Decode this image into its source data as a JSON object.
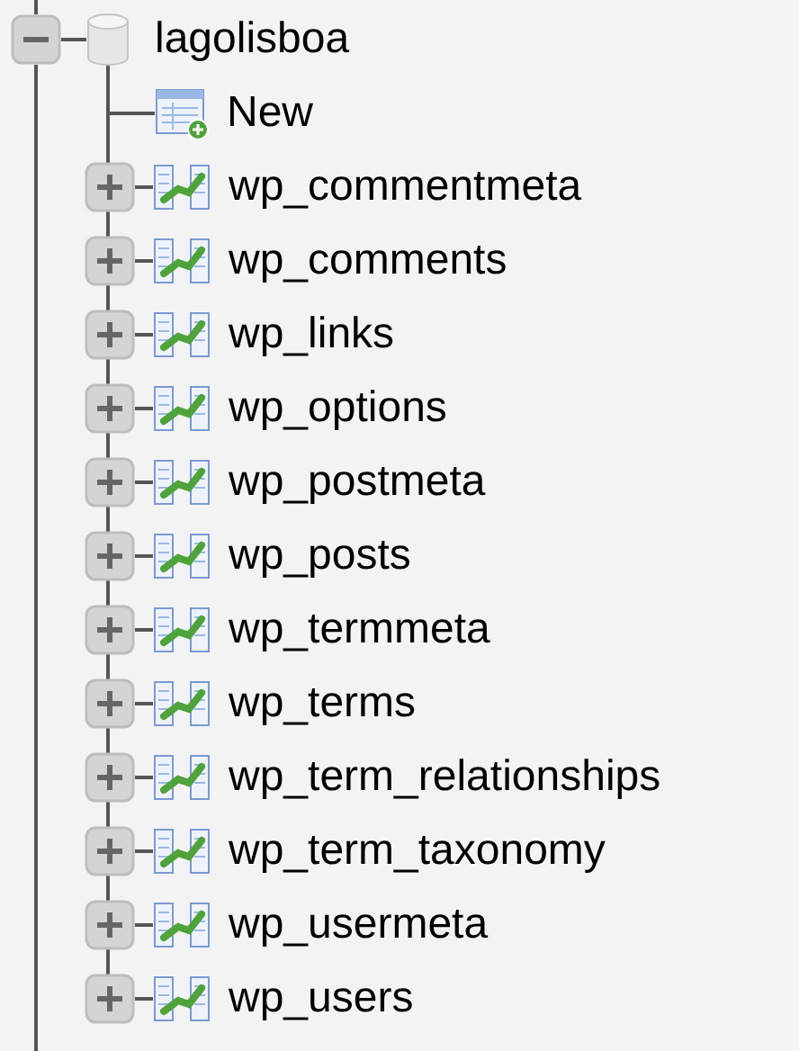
{
  "database": {
    "name": "lagolisboa",
    "expanded": true,
    "new_label": "New",
    "tables": [
      {
        "name": "wp_commentmeta",
        "expanded": false
      },
      {
        "name": "wp_comments",
        "expanded": false
      },
      {
        "name": "wp_links",
        "expanded": false
      },
      {
        "name": "wp_options",
        "expanded": false
      },
      {
        "name": "wp_postmeta",
        "expanded": false
      },
      {
        "name": "wp_posts",
        "expanded": false
      },
      {
        "name": "wp_termmeta",
        "expanded": false
      },
      {
        "name": "wp_terms",
        "expanded": false
      },
      {
        "name": "wp_term_relationships",
        "expanded": false
      },
      {
        "name": "wp_term_taxonomy",
        "expanded": false
      },
      {
        "name": "wp_usermeta",
        "expanded": false
      },
      {
        "name": "wp_users",
        "expanded": false
      }
    ]
  }
}
